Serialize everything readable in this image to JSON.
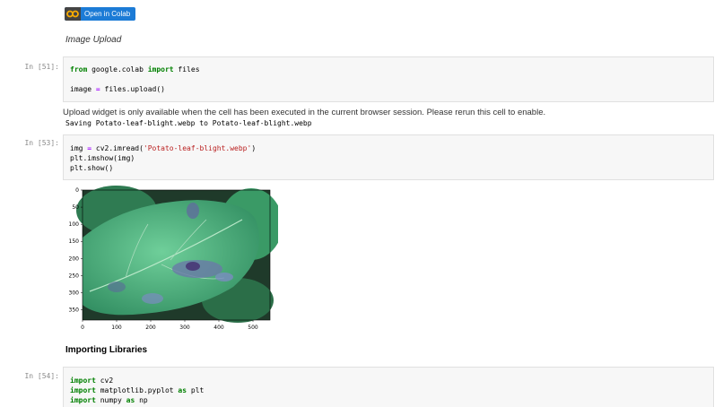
{
  "badge": {
    "label": "Open in Colab"
  },
  "cells": {
    "md1": {
      "text": "Image Upload"
    },
    "c1": {
      "prompt": "In [51]:",
      "lines": [
        [
          {
            "t": "from",
            "c": "kw"
          },
          {
            "t": " google.colab ",
            "c": ""
          },
          {
            "t": "import",
            "c": "kw"
          },
          {
            "t": " files",
            "c": ""
          }
        ],
        [],
        [
          {
            "t": "image ",
            "c": ""
          },
          {
            "t": "=",
            "c": "op"
          },
          {
            "t": " files.upload()",
            "c": ""
          }
        ]
      ],
      "widget_msg": "Upload widget is only available when the cell has been executed in the current browser session. Please rerun this cell to enable.",
      "output": "Saving Potato-leaf-blight.webp to Potato-leaf-blight.webp"
    },
    "c2": {
      "prompt": "In [53]:",
      "lines": [
        [
          {
            "t": "img ",
            "c": ""
          },
          {
            "t": "=",
            "c": "op"
          },
          {
            "t": " cv2.imread(",
            "c": ""
          },
          {
            "t": "'Potato-leaf-blight.webp'",
            "c": "str"
          },
          {
            "t": ")",
            "c": ""
          }
        ],
        [
          {
            "t": "plt.imshow(img)",
            "c": ""
          }
        ],
        [
          {
            "t": "plt.show()",
            "c": ""
          }
        ]
      ]
    },
    "md2": {
      "text": "Importing Libraries"
    },
    "c3": {
      "prompt": "In [54]:",
      "lines": [
        [
          {
            "t": "import",
            "c": "kw"
          },
          {
            "t": " cv2",
            "c": ""
          }
        ],
        [
          {
            "t": "import",
            "c": "kw"
          },
          {
            "t": " matplotlib.pyplot ",
            "c": ""
          },
          {
            "t": "as",
            "c": "kw"
          },
          {
            "t": " plt",
            "c": ""
          }
        ],
        [
          {
            "t": "import",
            "c": "kw"
          },
          {
            "t": " numpy ",
            "c": ""
          },
          {
            "t": "as",
            "c": "kw"
          },
          {
            "t": " np",
            "c": ""
          }
        ]
      ]
    }
  },
  "plot": {
    "y_ticks": [
      "0",
      "50",
      "100",
      "150",
      "200",
      "250",
      "300",
      "350"
    ],
    "x_ticks": [
      "0",
      "100",
      "200",
      "300",
      "400",
      "500"
    ],
    "image_subject": "potato leaf with blight"
  }
}
